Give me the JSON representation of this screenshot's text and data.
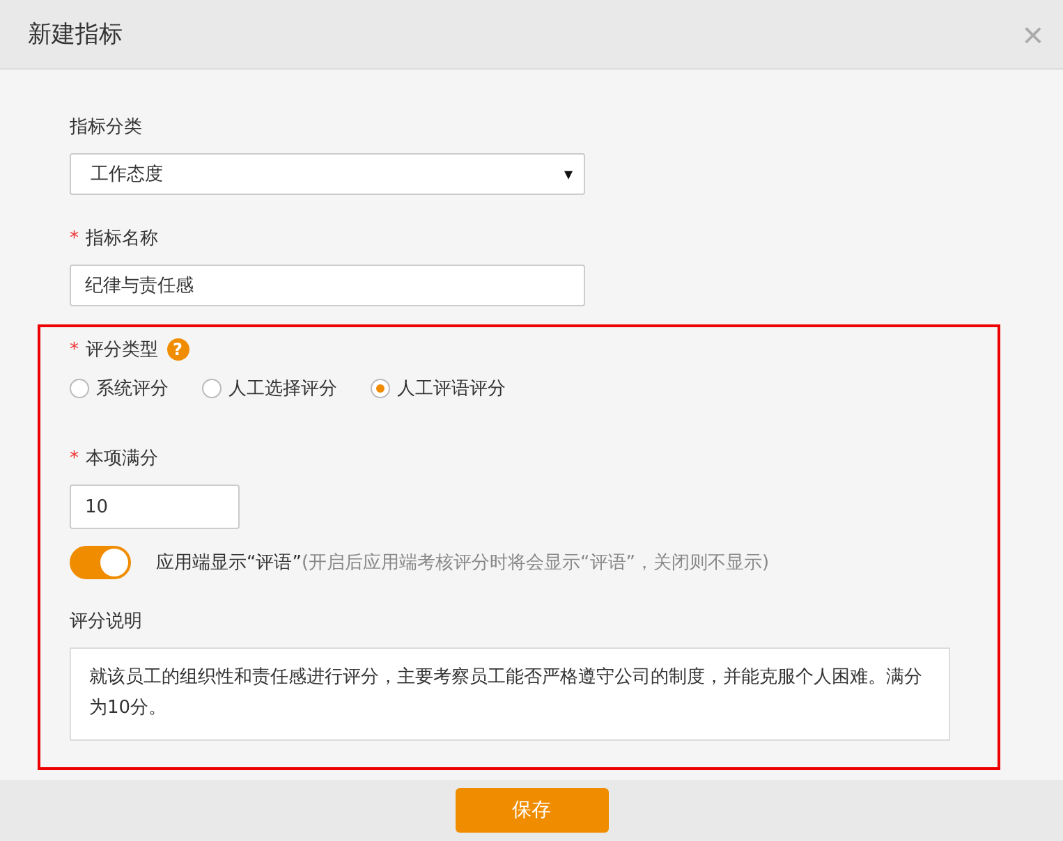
{
  "dialog": {
    "title": "新建指标",
    "close": "×"
  },
  "category": {
    "label": "指标分类",
    "value": "工作态度",
    "caret": "▾"
  },
  "name": {
    "label": "指标名称",
    "required_mark": "*",
    "value": "纪律与责任感"
  },
  "score_type": {
    "label": "评分类型",
    "required_mark": "*",
    "help": "?",
    "options": [
      {
        "label": "系统评分",
        "selected": false
      },
      {
        "label": "人工选择评分",
        "selected": false
      },
      {
        "label": "人工评语评分",
        "selected": true
      }
    ]
  },
  "full_score": {
    "label": "本项满分",
    "required_mark": "*",
    "value": "10"
  },
  "show_comment": {
    "on": true,
    "label": "应用端显示“评语”",
    "hint": "(开启后应用端考核评分时将会显示“评语”，关闭则不显示)"
  },
  "description": {
    "label": "评分说明",
    "value": "就该员工的组织性和责任感进行评分，主要考察员工能否严格遵守公司的制度，并能克服个人困难。满分为10分。"
  },
  "buttons": [
    "保存"
  ]
}
